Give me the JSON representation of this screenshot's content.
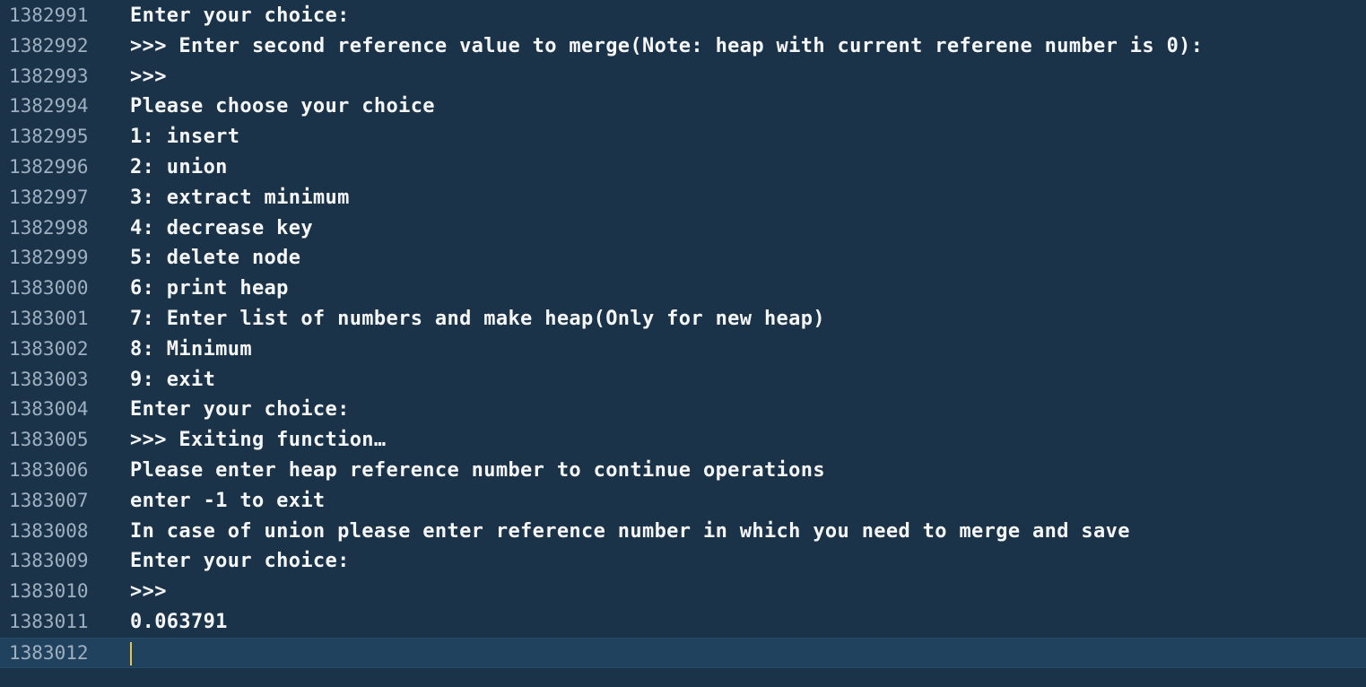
{
  "editor": {
    "lines": [
      {
        "number": "1382991",
        "text": "Enter your choice:"
      },
      {
        "number": "1382992",
        "text": ">>> Enter second reference value to merge(Note: heap with current referene number is 0):"
      },
      {
        "number": "1382993",
        "text": ">>>"
      },
      {
        "number": "1382994",
        "text": "Please choose your choice"
      },
      {
        "number": "1382995",
        "text": "1: insert"
      },
      {
        "number": "1382996",
        "text": "2: union"
      },
      {
        "number": "1382997",
        "text": "3: extract minimum"
      },
      {
        "number": "1382998",
        "text": "4: decrease key"
      },
      {
        "number": "1382999",
        "text": "5: delete node"
      },
      {
        "number": "1383000",
        "text": "6: print heap"
      },
      {
        "number": "1383001",
        "text": "7: Enter list of numbers and make heap(Only for new heap)"
      },
      {
        "number": "1383002",
        "text": "8: Minimum"
      },
      {
        "number": "1383003",
        "text": "9: exit"
      },
      {
        "number": "1383004",
        "text": "Enter your choice:"
      },
      {
        "number": "1383005",
        "text": ">>> Exiting function…"
      },
      {
        "number": "1383006",
        "text": "Please enter heap reference number to continue operations"
      },
      {
        "number": "1383007",
        "text": "enter -1 to exit"
      },
      {
        "number": "1383008",
        "text": "In case of union please enter reference number in which you need to merge and save"
      },
      {
        "number": "1383009",
        "text": "Enter your choice:"
      },
      {
        "number": "1383010",
        "text": ">>>"
      },
      {
        "number": "1383011",
        "text": "0.063791"
      },
      {
        "number": "1383012",
        "text": ""
      }
    ],
    "colors": {
      "background": "#1b3349",
      "current_line": "#21425e",
      "line_number": "#9fb0bf",
      "text": "#f4f6f8",
      "caret": "#e6c44a"
    }
  }
}
